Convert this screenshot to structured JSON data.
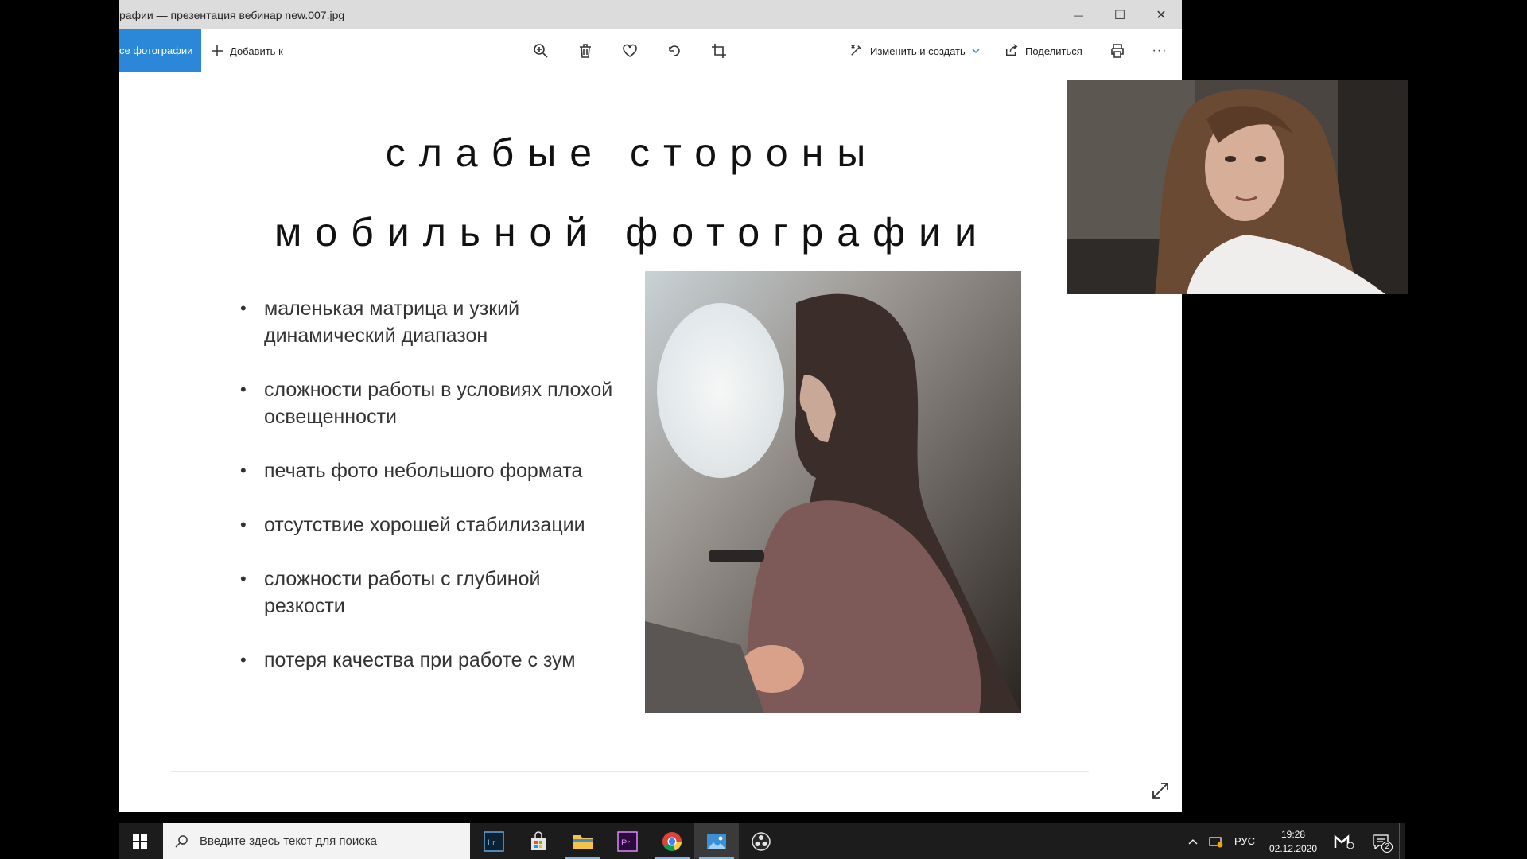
{
  "window": {
    "title": "рафии — презентация вебинар new.007.jpg",
    "controls": {
      "minimize": "—",
      "maximize": "☐",
      "close": "✕"
    }
  },
  "toolbar": {
    "all_photos_label": "се фотографии",
    "add_label": "Добавить к",
    "edit_create_label": "Изменить и создать",
    "share_label": "Поделиться",
    "more_label": "···",
    "icons": [
      "zoom-icon",
      "delete-icon",
      "favorite-icon",
      "rotate-icon",
      "crop-icon",
      "print-icon"
    ]
  },
  "slide": {
    "title_line1": "слабые стороны",
    "title_line2": "мобильной фотографии",
    "bullets": [
      "маленькая матрица и узкий динамический диапазон",
      "сложности работы в условиях плохой освещенности",
      "печать фото небольшого формата",
      "отсутствие хорошей стабилизации",
      "сложности работы с глубиной резкости",
      "потеря качества при работе с зум"
    ]
  },
  "taskbar": {
    "search_placeholder": "Введите здесь текст для поиска",
    "apps": [
      "Lr",
      "store",
      "explorer",
      "Pr",
      "chrome",
      "photos",
      "obs"
    ],
    "active_app": "photos",
    "language": "РУС",
    "time": "19:28",
    "date": "02.12.2020",
    "notification_count": "2"
  },
  "colors": {
    "accent": "#2b88d8",
    "taskbar": "#1c1c1c",
    "titlebar": "#dcdcdc"
  }
}
